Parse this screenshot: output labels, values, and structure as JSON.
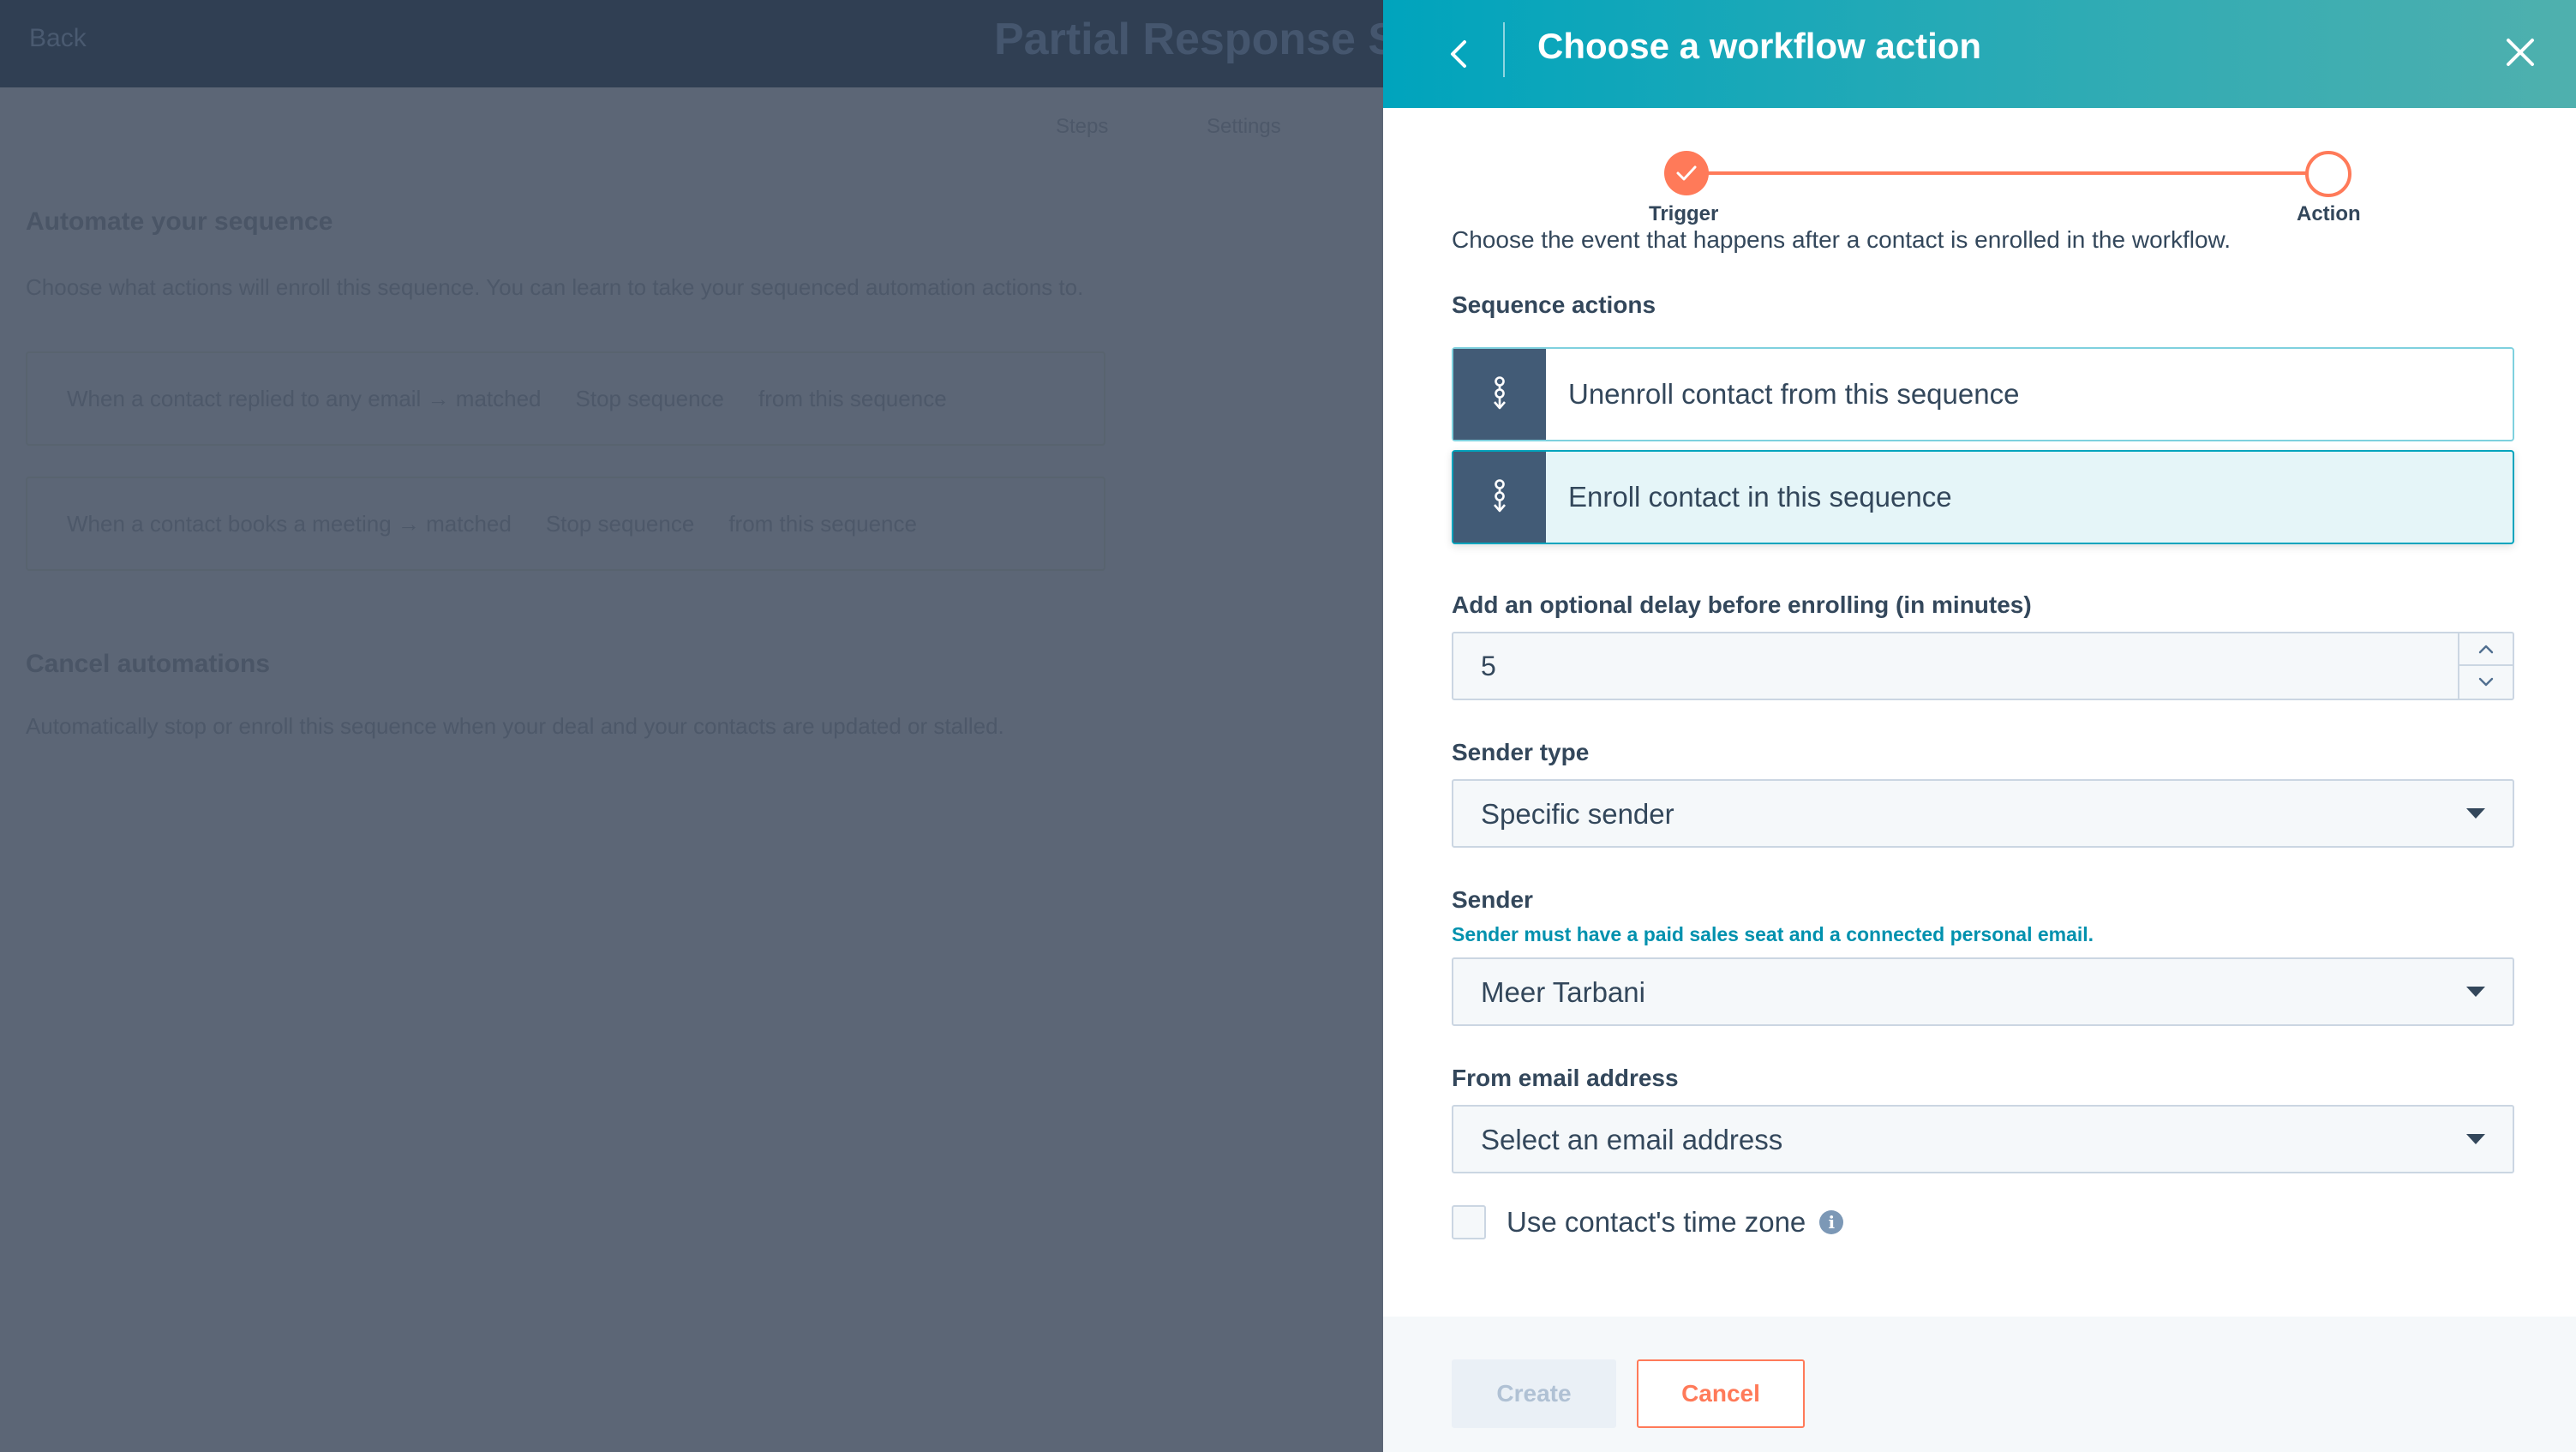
{
  "background": {
    "back_label": "Back",
    "title": "Partial Response Seq",
    "tabs": [
      "Steps",
      "Settings"
    ],
    "automate_heading": "Automate your sequence",
    "automate_desc": "Choose what actions will enroll this sequence. You can learn to take your sequenced automation actions to.",
    "rows": [
      {
        "trigger": "When a contact replied to any email → matched",
        "action": "Stop sequence",
        "result": "from this sequence"
      },
      {
        "trigger": "When a contact books a meeting → matched",
        "action": "Stop sequence",
        "result": "from this sequence"
      }
    ],
    "cancel_heading": "Cancel automations",
    "cancel_desc": "Automatically stop or enroll this sequence when your deal and your contacts are updated or stalled."
  },
  "panel": {
    "title": "Choose a workflow action",
    "steps": [
      {
        "label": "Trigger",
        "state": "complete"
      },
      {
        "label": "Action",
        "state": "current"
      }
    ],
    "intro": "Choose the event that happens after a contact is enrolled in the workflow.",
    "sequence_actions_label": "Sequence actions",
    "actions": [
      {
        "label": "Unenroll contact from this sequence",
        "selected": false,
        "icon": "sequence-icon"
      },
      {
        "label": "Enroll contact in this sequence",
        "selected": true,
        "icon": "sequence-icon"
      }
    ],
    "delay_label": "Add an optional delay before enrolling (in minutes)",
    "delay_value": "5",
    "sender_type_label": "Sender type",
    "sender_type_value": "Specific sender",
    "sender_label": "Sender",
    "sender_help": "Sender must have a paid sales seat and a connected personal email.",
    "sender_value": "Meer Tarbani",
    "from_email_label": "From email address",
    "from_email_placeholder": "Select an email address",
    "timezone_label": "Use contact's time zone",
    "timezone_checked": false,
    "create_label": "Create",
    "cancel_label": "Cancel"
  },
  "colors": {
    "accent": "#00a4bd",
    "progress": "#ff7a59",
    "text": "#33475b",
    "overlay": "#5c6676"
  }
}
